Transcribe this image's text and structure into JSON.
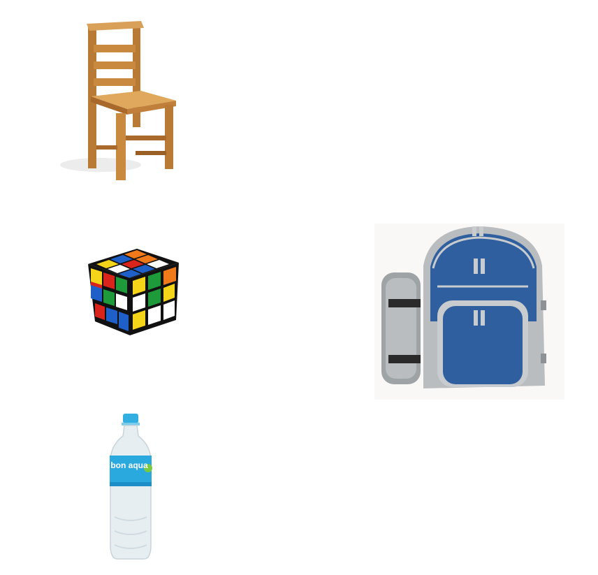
{
  "images": [
    {
      "id": "chair",
      "icon": "wooden-chair-icon",
      "colors": {
        "wood": "#c98a3f",
        "wood_dark": "#9a5f24",
        "wood_light": "#e0a85c"
      }
    },
    {
      "id": "cube",
      "icon": "rubiks-cube-icon",
      "colors": {
        "red": "#d9241c",
        "blue": "#1f5fc8",
        "green": "#1f9a3a",
        "yellow": "#f5d51a",
        "orange": "#f07a1a",
        "white": "#ffffff",
        "black": "#111111"
      }
    },
    {
      "id": "backpack",
      "icon": "picnic-backpack-icon",
      "colors": {
        "blue": "#2f5f9e",
        "grey": "#b9bdc0",
        "grey_dark": "#8d9296",
        "black": "#2a2a2a"
      }
    },
    {
      "id": "bottle",
      "icon": "water-bottle-icon",
      "colors": {
        "cap": "#33aee0",
        "label": "#2aa9df",
        "label_dark": "#1d8ec7",
        "plastic": "#e6eef2"
      }
    }
  ],
  "bottle_label": {
    "brand": "bon aqua"
  }
}
